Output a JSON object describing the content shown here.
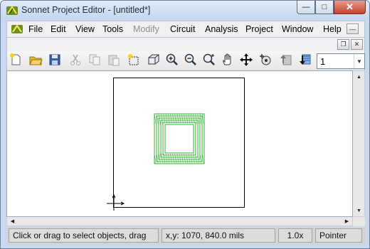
{
  "window": {
    "title": "Sonnet Project Editor - [untitled*]"
  },
  "window_buttons": {
    "minimize": "—",
    "maximize": "□",
    "close": "✕"
  },
  "menu": {
    "items": [
      {
        "label": "File",
        "enabled": true
      },
      {
        "label": "Edit",
        "enabled": true
      },
      {
        "label": "View",
        "enabled": true
      },
      {
        "label": "Tools",
        "enabled": true
      },
      {
        "label": "Modify",
        "enabled": false
      },
      {
        "label": "Circuit",
        "enabled": true
      },
      {
        "label": "Analysis",
        "enabled": true
      },
      {
        "label": "Project",
        "enabled": true
      },
      {
        "label": "Window",
        "enabled": true
      },
      {
        "label": "Help",
        "enabled": true
      }
    ],
    "mdi_buttons": {
      "minimize": "—",
      "restore": "❐",
      "close": "✕"
    }
  },
  "toolbar": {
    "icons": [
      "new-file-icon",
      "open-folder-icon",
      "save-icon",
      "cut-icon",
      "copy-icon",
      "paste-icon",
      "select-box-icon",
      "3d-view-icon",
      "zoom-in-icon",
      "zoom-out-icon",
      "zoom-fit-icon",
      "pan-hand-icon",
      "move-icon",
      "rotate-icon",
      "up-level-icon",
      "down-level-icon"
    ],
    "level_value": "1",
    "level_arrow": "▼"
  },
  "scroll": {
    "up": "▲",
    "down": "▼",
    "left": "◀",
    "right": "▶"
  },
  "colors": {
    "spiral": "#35b035",
    "canvas_bg": "#ffffff"
  },
  "status": {
    "message": "Click or drag to select objects, drag",
    "coords": "x,y:  1070, 840.0 mils",
    "zoom": "1.0x",
    "mode": "Pointer"
  }
}
